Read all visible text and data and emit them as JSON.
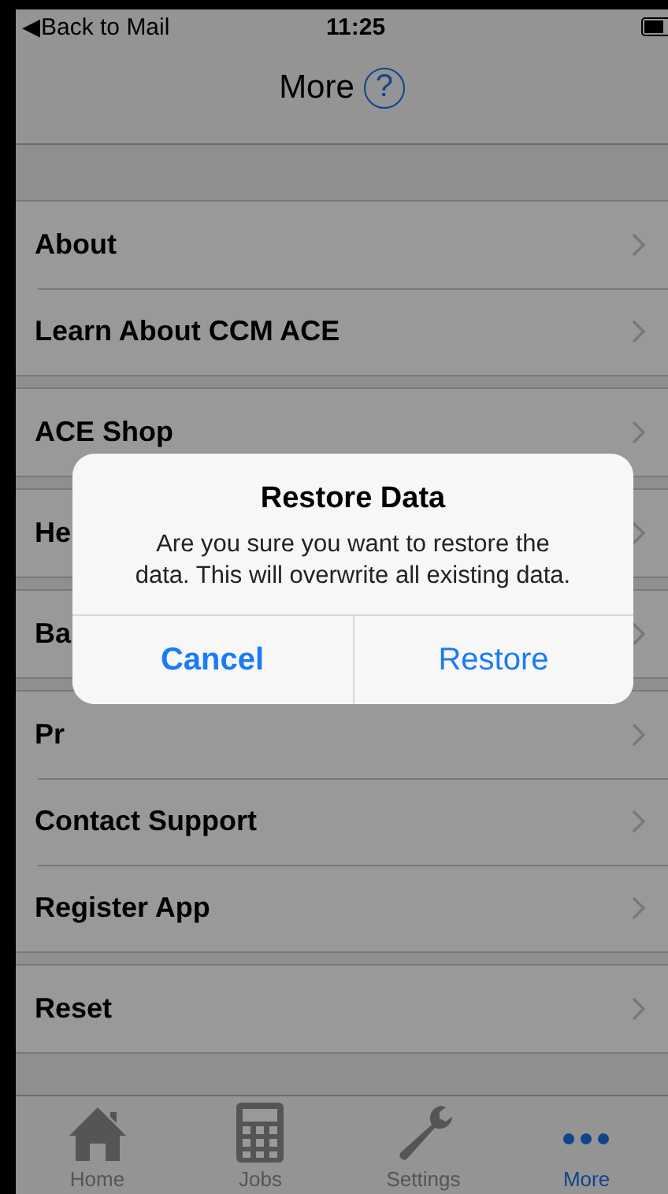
{
  "status_bar": {
    "back": "◀Back to Mail",
    "time": "11:25"
  },
  "nav_bar": {
    "title": "More",
    "help": "?"
  },
  "sections": [
    {
      "rows": [
        {
          "label": "About"
        },
        {
          "label": "Learn About CCM ACE"
        }
      ]
    },
    {
      "rows": [
        {
          "label": "ACE Shop"
        }
      ]
    },
    {
      "rows": [
        {
          "label": "He"
        }
      ]
    },
    {
      "rows": [
        {
          "label": "Ba"
        }
      ]
    },
    {
      "rows": [
        {
          "label": "Pr"
        },
        {
          "label": "Contact Support"
        },
        {
          "label": "Register App"
        }
      ]
    },
    {
      "rows": [
        {
          "label": "Reset"
        }
      ]
    }
  ],
  "dialog": {
    "title": "Restore Data",
    "message": "Are you sure you want to restore the data. This will overwrite all existing data.",
    "buttons": [
      {
        "label": "Cancel",
        "kind": "cancel"
      },
      {
        "label": "Restore",
        "kind": "default"
      }
    ]
  },
  "tabs": [
    {
      "label": "Home",
      "selected": false
    },
    {
      "label": "Jobs",
      "selected": false
    },
    {
      "label": "Settings",
      "selected": false
    },
    {
      "label": "More",
      "selected": true
    }
  ]
}
